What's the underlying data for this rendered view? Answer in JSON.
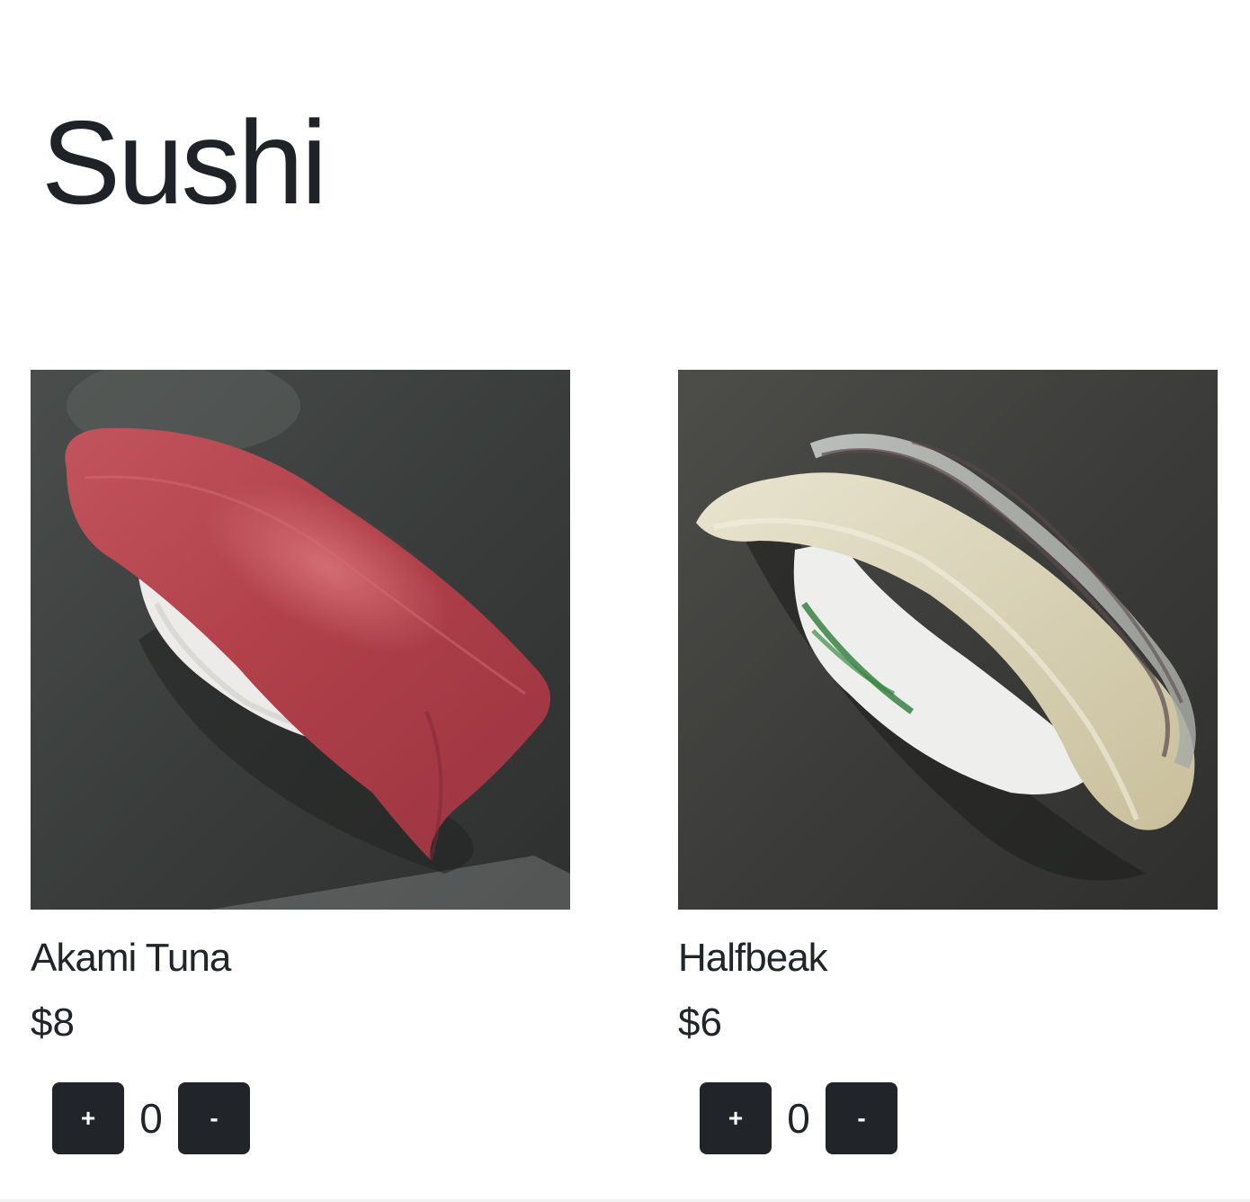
{
  "page": {
    "title": "Sushi"
  },
  "items": [
    {
      "name": "Akami Tuna",
      "price": "$8",
      "quantity": "0",
      "plus_label": "+",
      "minus_label": "-",
      "image": "akami-tuna-nigiri-photo"
    },
    {
      "name": "Halfbeak",
      "price": "$6",
      "quantity": "0",
      "plus_label": "+",
      "minus_label": "-",
      "image": "halfbeak-nigiri-photo"
    }
  ]
}
